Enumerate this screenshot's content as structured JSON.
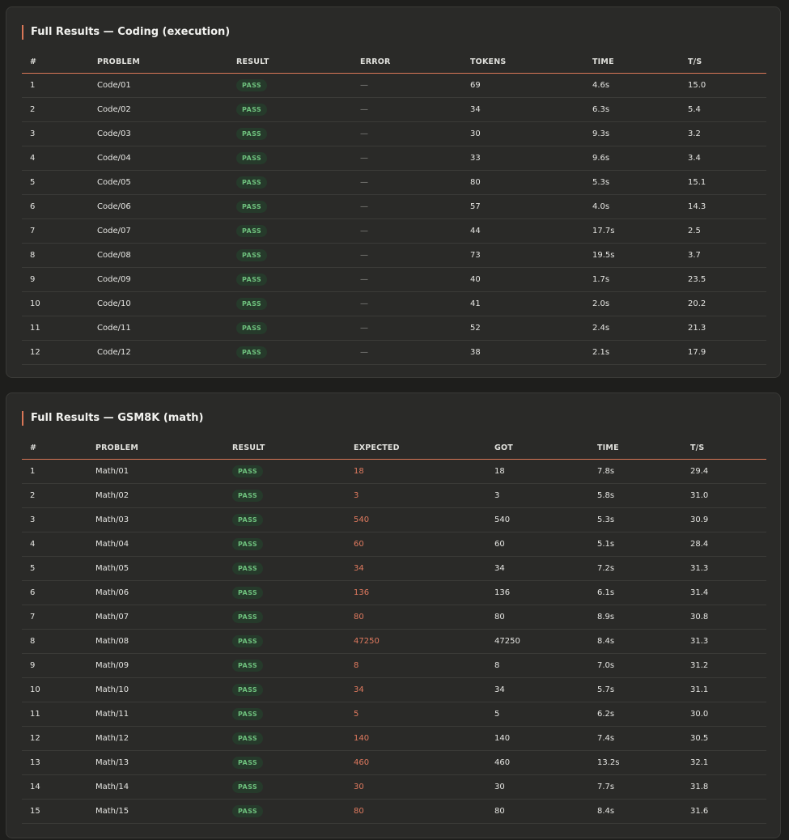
{
  "coding": {
    "title": "Full Results — Coding (execution)",
    "headers": [
      "#",
      "PROBLEM",
      "RESULT",
      "ERROR",
      "TOKENS",
      "TIME",
      "T/S"
    ],
    "rows": [
      {
        "num": "1",
        "problem": "Code/01",
        "result": "PASS",
        "error": "—",
        "tokens": "69",
        "time": "4.6s",
        "ts": "15.0"
      },
      {
        "num": "2",
        "problem": "Code/02",
        "result": "PASS",
        "error": "—",
        "tokens": "34",
        "time": "6.3s",
        "ts": "5.4"
      },
      {
        "num": "3",
        "problem": "Code/03",
        "result": "PASS",
        "error": "—",
        "tokens": "30",
        "time": "9.3s",
        "ts": "3.2"
      },
      {
        "num": "4",
        "problem": "Code/04",
        "result": "PASS",
        "error": "—",
        "tokens": "33",
        "time": "9.6s",
        "ts": "3.4"
      },
      {
        "num": "5",
        "problem": "Code/05",
        "result": "PASS",
        "error": "—",
        "tokens": "80",
        "time": "5.3s",
        "ts": "15.1"
      },
      {
        "num": "6",
        "problem": "Code/06",
        "result": "PASS",
        "error": "—",
        "tokens": "57",
        "time": "4.0s",
        "ts": "14.3"
      },
      {
        "num": "7",
        "problem": "Code/07",
        "result": "PASS",
        "error": "—",
        "tokens": "44",
        "time": "17.7s",
        "ts": "2.5"
      },
      {
        "num": "8",
        "problem": "Code/08",
        "result": "PASS",
        "error": "—",
        "tokens": "73",
        "time": "19.5s",
        "ts": "3.7"
      },
      {
        "num": "9",
        "problem": "Code/09",
        "result": "PASS",
        "error": "—",
        "tokens": "40",
        "time": "1.7s",
        "ts": "23.5"
      },
      {
        "num": "10",
        "problem": "Code/10",
        "result": "PASS",
        "error": "—",
        "tokens": "41",
        "time": "2.0s",
        "ts": "20.2"
      },
      {
        "num": "11",
        "problem": "Code/11",
        "result": "PASS",
        "error": "—",
        "tokens": "52",
        "time": "2.4s",
        "ts": "21.3"
      },
      {
        "num": "12",
        "problem": "Code/12",
        "result": "PASS",
        "error": "—",
        "tokens": "38",
        "time": "2.1s",
        "ts": "17.9"
      }
    ]
  },
  "math": {
    "title": "Full Results — GSM8K (math)",
    "headers": [
      "#",
      "PROBLEM",
      "RESULT",
      "EXPECTED",
      "GOT",
      "TIME",
      "T/S"
    ],
    "rows": [
      {
        "num": "1",
        "problem": "Math/01",
        "result": "PASS",
        "expected": "18",
        "got": "18",
        "time": "7.8s",
        "ts": "29.4"
      },
      {
        "num": "2",
        "problem": "Math/02",
        "result": "PASS",
        "expected": "3",
        "got": "3",
        "time": "5.8s",
        "ts": "31.0"
      },
      {
        "num": "3",
        "problem": "Math/03",
        "result": "PASS",
        "expected": "540",
        "got": "540",
        "time": "5.3s",
        "ts": "30.9"
      },
      {
        "num": "4",
        "problem": "Math/04",
        "result": "PASS",
        "expected": "60",
        "got": "60",
        "time": "5.1s",
        "ts": "28.4"
      },
      {
        "num": "5",
        "problem": "Math/05",
        "result": "PASS",
        "expected": "34",
        "got": "34",
        "time": "7.2s",
        "ts": "31.3"
      },
      {
        "num": "6",
        "problem": "Math/06",
        "result": "PASS",
        "expected": "136",
        "got": "136",
        "time": "6.1s",
        "ts": "31.4"
      },
      {
        "num": "7",
        "problem": "Math/07",
        "result": "PASS",
        "expected": "80",
        "got": "80",
        "time": "8.9s",
        "ts": "30.8"
      },
      {
        "num": "8",
        "problem": "Math/08",
        "result": "PASS",
        "expected": "47250",
        "got": "47250",
        "time": "8.4s",
        "ts": "31.3"
      },
      {
        "num": "9",
        "problem": "Math/09",
        "result": "PASS",
        "expected": "8",
        "got": "8",
        "time": "7.0s",
        "ts": "31.2"
      },
      {
        "num": "10",
        "problem": "Math/10",
        "result": "PASS",
        "expected": "34",
        "got": "34",
        "time": "5.7s",
        "ts": "31.1"
      },
      {
        "num": "11",
        "problem": "Math/11",
        "result": "PASS",
        "expected": "5",
        "got": "5",
        "time": "6.2s",
        "ts": "30.0"
      },
      {
        "num": "12",
        "problem": "Math/12",
        "result": "PASS",
        "expected": "140",
        "got": "140",
        "time": "7.4s",
        "ts": "30.5"
      },
      {
        "num": "13",
        "problem": "Math/13",
        "result": "PASS",
        "expected": "460",
        "got": "460",
        "time": "13.2s",
        "ts": "32.1"
      },
      {
        "num": "14",
        "problem": "Math/14",
        "result": "PASS",
        "expected": "30",
        "got": "30",
        "time": "7.7s",
        "ts": "31.8"
      },
      {
        "num": "15",
        "problem": "Math/15",
        "result": "PASS",
        "expected": "80",
        "got": "80",
        "time": "8.4s",
        "ts": "31.6"
      }
    ]
  },
  "colors": {
    "accent": "#d97757",
    "pass_text": "#6ec07d",
    "pass_bg": "#263a2b",
    "expected_text": "#e07a5f"
  }
}
